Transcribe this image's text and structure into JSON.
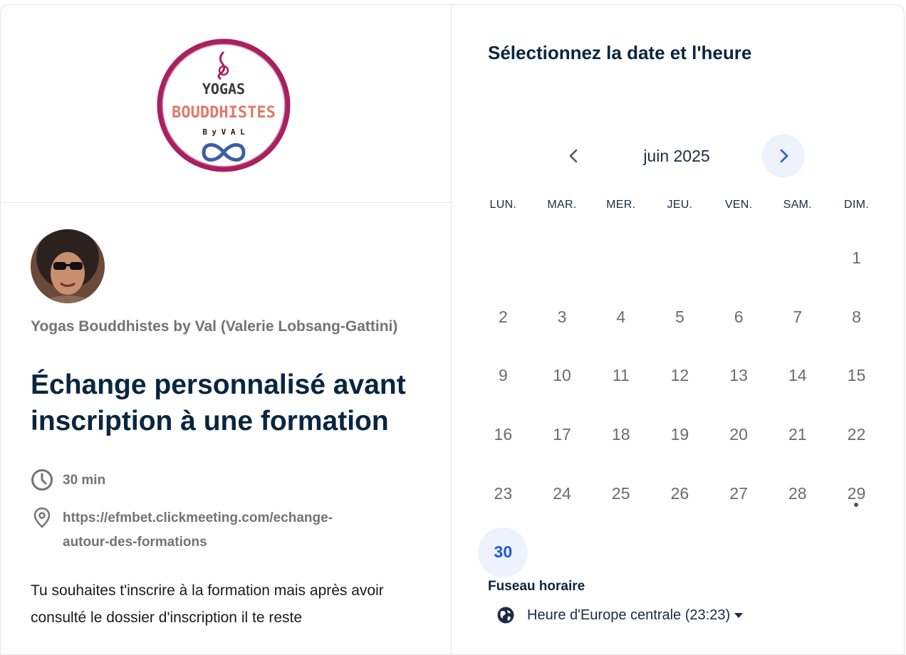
{
  "brand": {
    "logo_line1": "YOGAS",
    "logo_line2": "BOUDDHISTES",
    "logo_line3": "B y  V A L",
    "ring_color": "#a8205e",
    "accent_color": "#e07a6a"
  },
  "event": {
    "organizer": "Yogas Bouddhistes by Val (Valerie Lobsang-Gattini)",
    "title": "Échange personnalisé avant inscription à une formation",
    "duration": "30 min",
    "location": "https://efmbet.clickmeeting.com/echange-autour-des-formations",
    "description": "Tu souhaites t'inscrire à la formation mais après avoir consulté le dossier d'inscription il te reste",
    "duration_icon": "clock-icon",
    "location_icon": "map-pin-icon"
  },
  "calendar": {
    "heading": "Sélectionnez la date et l'heure",
    "month": "juin 2025",
    "prev_icon": "chevron-left-icon",
    "next_icon": "chevron-right-icon",
    "weekdays": [
      "LUN.",
      "MAR.",
      "MER.",
      "JEU.",
      "VEN.",
      "SAM.",
      "DIM."
    ],
    "weeks": [
      [
        "",
        "",
        "",
        "",
        "",
        "",
        "1"
      ],
      [
        "2",
        "3",
        "4",
        "5",
        "6",
        "7",
        "8"
      ],
      [
        "9",
        "10",
        "11",
        "12",
        "13",
        "14",
        "15"
      ],
      [
        "16",
        "17",
        "18",
        "19",
        "20",
        "21",
        "22"
      ],
      [
        "23",
        "24",
        "25",
        "26",
        "27",
        "28",
        "29"
      ],
      [
        "30",
        "",
        "",
        "",
        "",
        "",
        ""
      ]
    ],
    "selected_day": "30",
    "today_dot_day": "29",
    "accent_color": "#1d5bd8"
  },
  "timezone": {
    "label": "Fuseau horaire",
    "value": "Heure d'Europe centrale (23:23)",
    "icon": "globe-icon"
  }
}
